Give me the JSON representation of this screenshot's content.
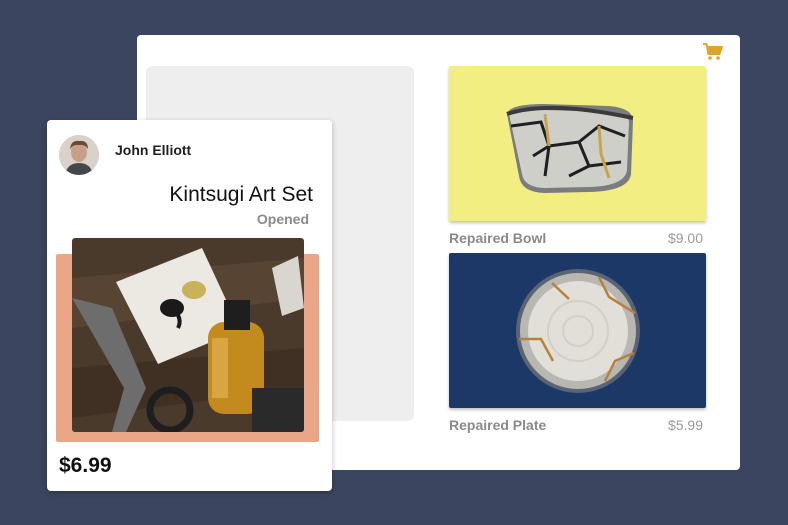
{
  "colors": {
    "background": "#3b4560",
    "cart_accent": "#e0a526",
    "bowl_tile_bg": "#f3ee82",
    "plate_tile_bg": "#1c3867",
    "photo_backdrop": "#eaa788"
  },
  "header": {
    "cart_icon": "shopping-cart-icon"
  },
  "products": [
    {
      "name": "Repaired Bowl",
      "price": "$9.00"
    },
    {
      "name": "Repaired Plate",
      "price": "$5.99"
    }
  ],
  "card": {
    "user": "John Elliott",
    "title": "Kintsugi Art Set",
    "status": "Opened",
    "price": "$6.99"
  }
}
